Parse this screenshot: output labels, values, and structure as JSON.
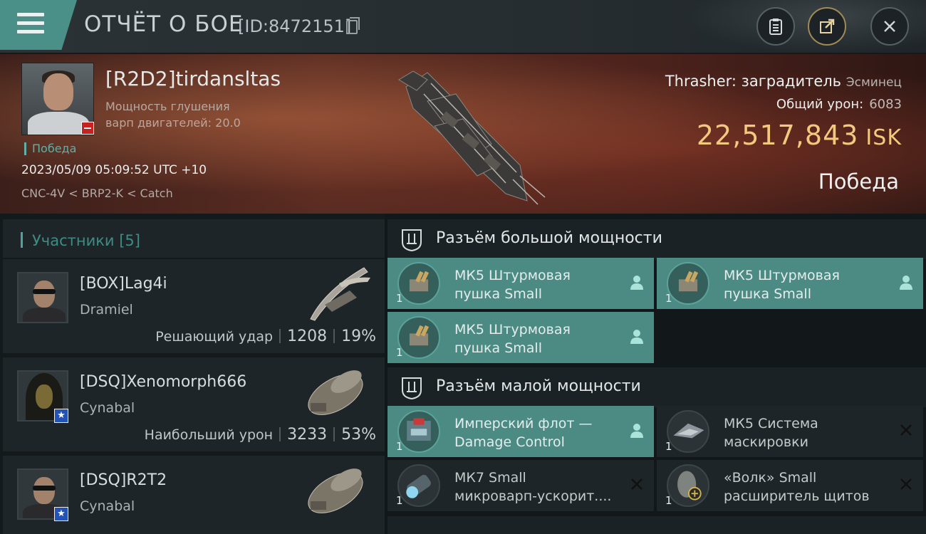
{
  "header": {
    "title": "ОТЧЁТ О БОЕ",
    "report_id": "[ID:8472151]",
    "icons": [
      "menu-icon",
      "copy-icon",
      "clipboard-icon",
      "share-icon",
      "close-icon"
    ]
  },
  "victim": {
    "name": "[R2D2]tirdansltas",
    "sub_line1": "Мощность глушения",
    "sub_line2": "варп двигателей: 20.0",
    "result_tag": "Победа",
    "datetime": "2023/05/09 05:09:52 UTC +10",
    "route": "CNC-4V < BRP2-K < Catch",
    "ship_name": "Thrasher: заградитель",
    "ship_class": "Эсминец",
    "total_damage_label": "Общий урон:",
    "total_damage": "6083",
    "isk_value": "22,517,843",
    "isk_unit": "ISK",
    "result": "Победа"
  },
  "participants": {
    "label": "Участники [5]",
    "items": [
      {
        "name": "[BOX]Lag4i",
        "ship": "Dramiel",
        "stat_label": "Решающий удар",
        "damage": "1208",
        "percent": "19%"
      },
      {
        "name": "[DSQ]Xenomorph666",
        "ship": "Cynabal",
        "stat_label": "Наибольший урон",
        "damage": "3233",
        "percent": "53%"
      },
      {
        "name": "[DSQ]R2T2",
        "ship": "Cynabal",
        "stat_label": "",
        "damage": "",
        "percent": ""
      }
    ]
  },
  "fitting": {
    "high_slot_label": "Разъём большой мощности",
    "low_slot_label": "Разъём малой мощности",
    "high_modules": [
      {
        "line1": "МК5 Штурмовая",
        "line2": "пушка Small",
        "qty": "1",
        "state": "dropped"
      },
      {
        "line1": "МК5 Штурмовая",
        "line2": "пушка Small",
        "qty": "1",
        "state": "dropped"
      },
      {
        "line1": "МК5 Штурмовая",
        "line2": "пушка Small",
        "qty": "1",
        "state": "dropped"
      }
    ],
    "low_modules": [
      {
        "line1": "Имперский флот —",
        "line2": "Damage Control",
        "qty": "1",
        "state": "dropped"
      },
      {
        "line1": "МК5 Система",
        "line2": "маскировки",
        "qty": "1",
        "state": "destroyed"
      },
      {
        "line1": "МК7 Small",
        "line2": "микроварп-ускорит....",
        "qty": "1",
        "state": "destroyed"
      },
      {
        "line1": "«Волк» Small",
        "line2": "расширитель щитов",
        "qty": "1",
        "state": "destroyed"
      }
    ]
  },
  "colors": {
    "accent": "#4b8b84",
    "isk": "#f3c980",
    "win": "#5fb0a6",
    "loss_badge": "#c92020"
  }
}
